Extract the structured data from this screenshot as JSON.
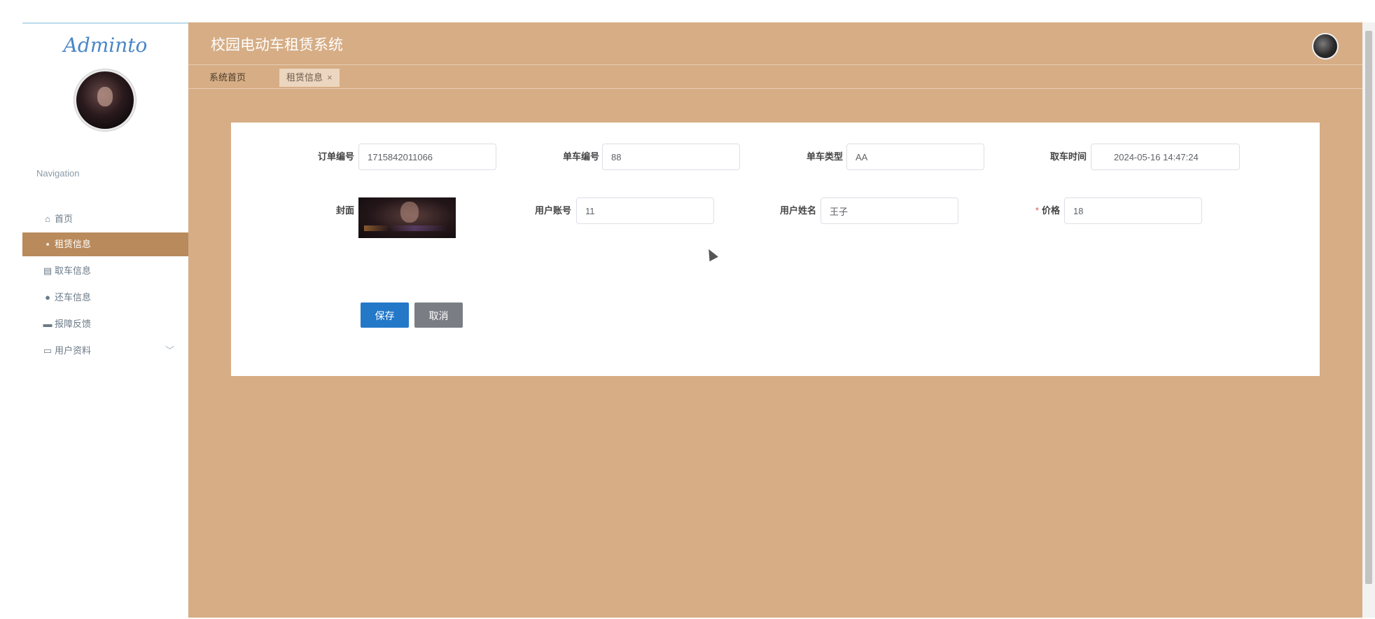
{
  "sidebar": {
    "logo": "Adminto",
    "nav_title": "Navigation",
    "items": [
      {
        "label": "首页",
        "icon": "home-icon"
      },
      {
        "label": "租赁信息",
        "icon": "briefcase-icon",
        "active": true
      },
      {
        "label": "取车信息",
        "icon": "document-icon"
      },
      {
        "label": "还车信息",
        "icon": "location-pin-icon"
      },
      {
        "label": "报障反馈",
        "icon": "monitor-icon"
      },
      {
        "label": "用户资料",
        "icon": "folder-icon",
        "has_submenu": true
      }
    ]
  },
  "header": {
    "title": "校园电动车租赁系统"
  },
  "tabs": [
    {
      "label": "系统首页"
    },
    {
      "label": "租赁信息",
      "active": true,
      "close": "×"
    }
  ],
  "form": {
    "order_no": {
      "label": "订单编号",
      "value": "1715842011066"
    },
    "bike_no": {
      "label": "单车编号",
      "value": "88"
    },
    "bike_type": {
      "label": "单车类型",
      "value": "AA"
    },
    "pickup_time": {
      "label": "取车时间",
      "value": "2024-05-16 14:47:24"
    },
    "cover": {
      "label": "封面"
    },
    "user_account": {
      "label": "用户账号",
      "value": "11"
    },
    "user_name": {
      "label": "用户姓名",
      "value": "王子"
    },
    "price": {
      "label": "价格",
      "value": "18",
      "required_mark": "*"
    }
  },
  "buttons": {
    "save": "保存",
    "cancel": "取消"
  },
  "colors": {
    "main_bg": "#d6ad85",
    "active_nav": "#b98a5c",
    "primary_button": "#2378c8",
    "secondary_button": "#7a7e84"
  }
}
